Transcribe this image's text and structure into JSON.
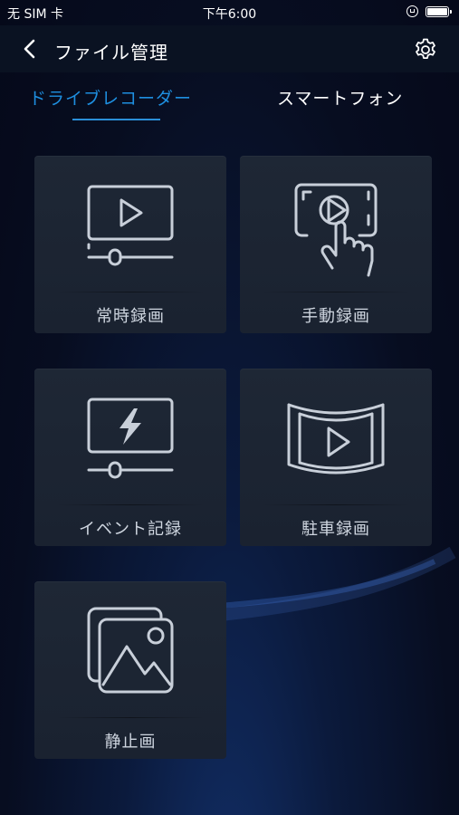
{
  "status": {
    "carrier": "无 SIM 卡",
    "time": "下午6:00"
  },
  "nav": {
    "title": "ファイル管理"
  },
  "tabs": [
    {
      "label": "ドライブレコーダー",
      "active": true
    },
    {
      "label": "スマートフォン",
      "active": false
    }
  ],
  "cards": [
    {
      "label": "常時録画",
      "icon": "video-play-icon"
    },
    {
      "label": "手動録画",
      "icon": "touch-play-icon"
    },
    {
      "label": "イベント記録",
      "icon": "lightning-video-icon"
    },
    {
      "label": "駐車録画",
      "icon": "panorama-play-icon"
    },
    {
      "label": "静止画",
      "icon": "image-gallery-icon"
    }
  ],
  "colors": {
    "accent": "#1e8fe0",
    "card": "#1e2735",
    "navbar": "#0a1222",
    "icon_stroke": "#c8cfd9"
  }
}
